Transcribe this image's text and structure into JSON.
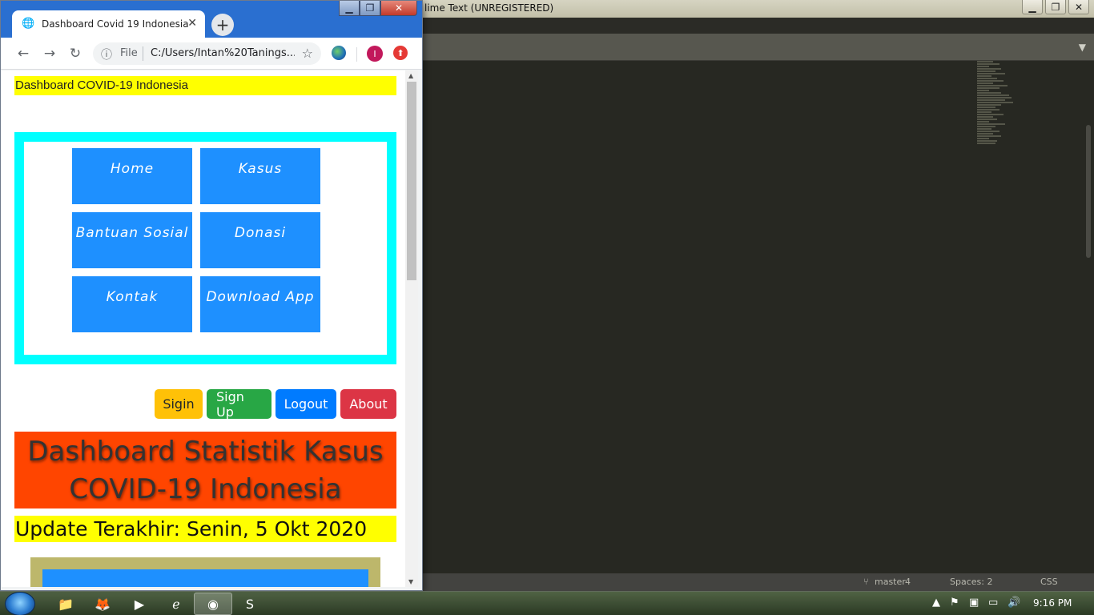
{
  "sublime": {
    "title": "lime Text (UNREGISTERED)",
    "status": {
      "branch": "master",
      "branch_count": "4",
      "indent": "Spaces: 2",
      "syntax": "CSS"
    }
  },
  "chrome": {
    "tab_title": "Dashboard Covid 19 Indonesia",
    "address_scheme": "File",
    "address_url": "C:/Users/Intan%20Tanings...",
    "profile_initial": "I"
  },
  "page": {
    "header_text": "Dashboard COVID-19 Indonesia",
    "nav_items": [
      {
        "label": "Home"
      },
      {
        "label": "Kasus"
      },
      {
        "label": "Bantuan Sosial"
      },
      {
        "label": "Donasi"
      },
      {
        "label": "Kontak"
      },
      {
        "label": "Download App"
      }
    ],
    "buttons": {
      "signin": "Sigin",
      "signup": "Sign Up",
      "logout": "Logout",
      "about": "About"
    },
    "hero_title": "Dashboard Statistik Kasus COVID-19 Indonesia",
    "update_text": "Update Terakhir: Senin, 5 Okt 2020"
  },
  "taskbar": {
    "clock": "9:16 PM",
    "apps": [
      "file-explorer",
      "firefox",
      "media-player",
      "edge",
      "chrome",
      "sublime-text"
    ]
  },
  "colors": {
    "header_bg": "#ffff00",
    "nav_frame": "#00ffff",
    "nav_button": "#1e90ff",
    "hero_bg": "#ff4500",
    "signin": "#ffc107",
    "signup": "#28a745",
    "logout": "#007bff",
    "about": "#dc3545",
    "stats_frame": "#bdb76b"
  }
}
